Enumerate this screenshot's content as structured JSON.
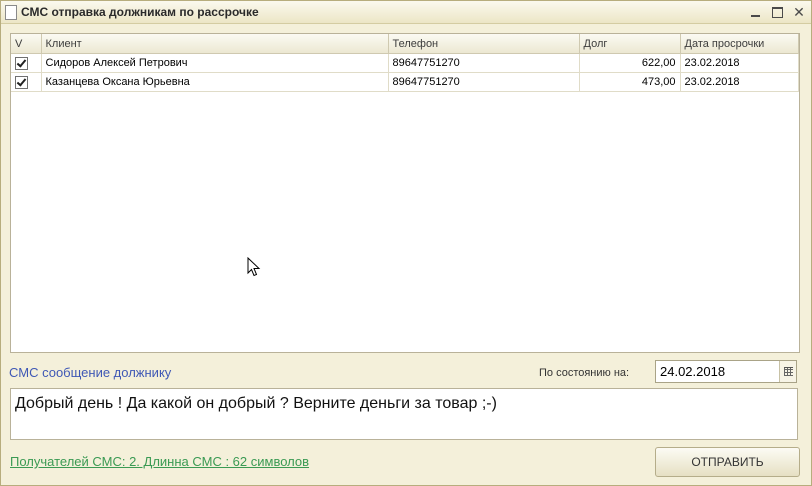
{
  "window": {
    "title": "СМС отправка должникам по рассрочке"
  },
  "grid": {
    "columns": [
      "V",
      "Клиент",
      "Телефон",
      "Долг",
      "Дата просрочки"
    ],
    "rows": [
      {
        "checked": true,
        "client": "Сидоров Алексей Петрович",
        "phone": "89647751270",
        "debt": "622,00",
        "due_date": "23.02.2018"
      },
      {
        "checked": true,
        "client": "Казанцева Оксана Юрьевна",
        "phone": "89647751270",
        "debt": "473,00",
        "due_date": "23.02.2018"
      }
    ]
  },
  "sms": {
    "label": "СМС сообщение должнику",
    "text": "Добрый день ! Да какой он добрый ? Верните деньги за товар ;-)"
  },
  "as_of": {
    "label": "По состоянию на:",
    "value": "24.02.2018"
  },
  "status_link": "Получателей СМС: 2. Длинна СМС : 62 символов",
  "send_button": "ОТПРАВИТЬ"
}
